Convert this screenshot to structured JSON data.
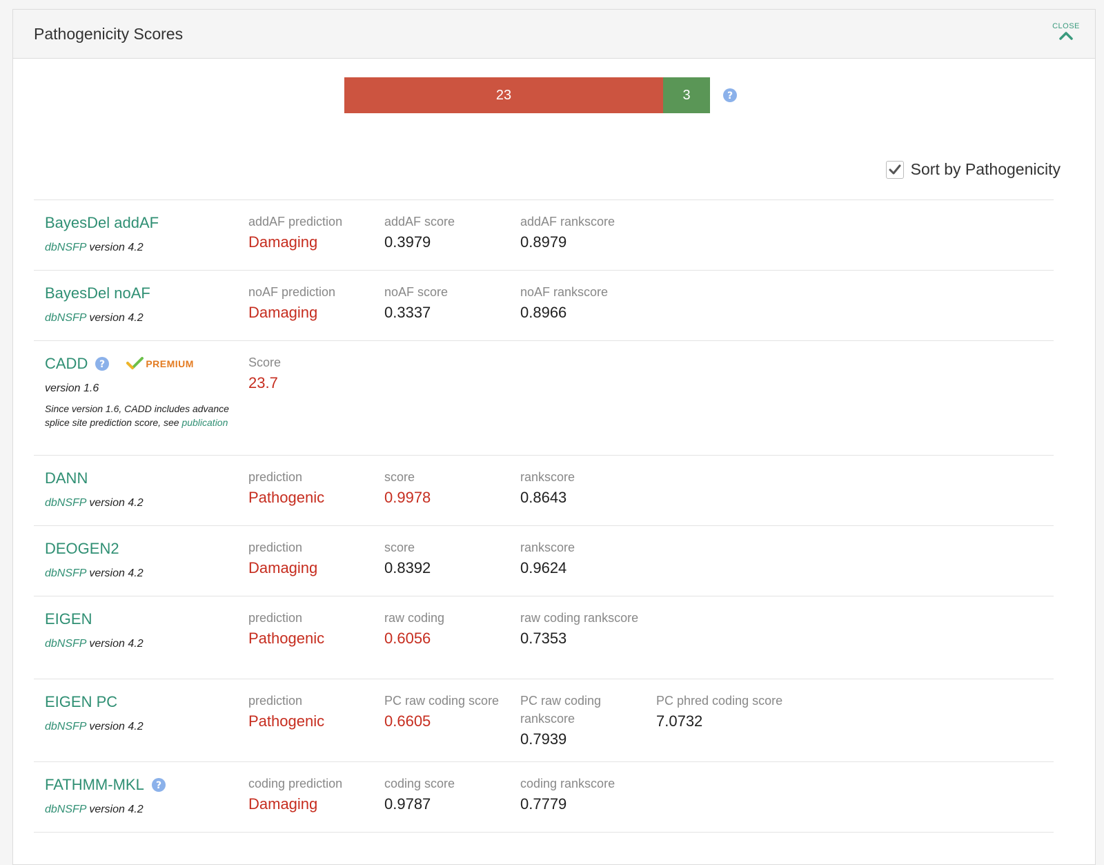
{
  "header": {
    "title": "Pathogenicity Scores",
    "close_label": "CLOSE"
  },
  "summary": {
    "damaging_count": "23",
    "benign_count": "3",
    "damaging_color": "#cc5440",
    "benign_color": "#5a9656"
  },
  "sort": {
    "label": "Sort by Pathogenicity",
    "checked": true
  },
  "rows": [
    {
      "name": "BayesDel addAF",
      "db": "dbNSFP",
      "version": " version 4.2",
      "metrics": [
        {
          "label": "addAF prediction",
          "value": "Damaging",
          "color": "red"
        },
        {
          "label": "addAF score",
          "value": "0.3979",
          "color": "dark"
        },
        {
          "label": "addAF rankscore",
          "value": "0.8979",
          "color": "dark"
        }
      ]
    },
    {
      "name": "BayesDel noAF",
      "db": "dbNSFP",
      "version": " version 4.2",
      "metrics": [
        {
          "label": "noAF prediction",
          "value": "Damaging",
          "color": "red"
        },
        {
          "label": "noAF score",
          "value": "0.3337",
          "color": "dark"
        },
        {
          "label": "noAF rankscore",
          "value": "0.8966",
          "color": "dark"
        }
      ]
    },
    {
      "name": "CADD",
      "premium_label": "PREMIUM",
      "version": "version 1.6",
      "note": "Since version 1.6, CADD includes advance splice site prediction score, see ",
      "note_link": "publication",
      "metrics": [
        {
          "label": "Score",
          "value": "23.7",
          "color": "red"
        }
      ]
    },
    {
      "name": "DANN",
      "db": "dbNSFP",
      "version": " version 4.2",
      "metrics": [
        {
          "label": "prediction",
          "value": "Pathogenic",
          "color": "red"
        },
        {
          "label": "score",
          "value": "0.9978",
          "color": "red"
        },
        {
          "label": "rankscore",
          "value": "0.8643",
          "color": "dark"
        }
      ]
    },
    {
      "name": "DEOGEN2",
      "db": "dbNSFP",
      "version": " version 4.2",
      "metrics": [
        {
          "label": "prediction",
          "value": "Damaging",
          "color": "red"
        },
        {
          "label": "score",
          "value": "0.8392",
          "color": "dark"
        },
        {
          "label": "rankscore",
          "value": "0.9624",
          "color": "dark"
        }
      ]
    },
    {
      "name": "EIGEN",
      "db": "dbNSFP",
      "version": " version 4.2",
      "metrics": [
        {
          "label": "prediction",
          "value": "Pathogenic",
          "color": "red"
        },
        {
          "label": "raw coding",
          "value": "0.6056",
          "color": "red"
        },
        {
          "label": "raw coding rankscore",
          "value": "0.7353",
          "color": "dark"
        }
      ]
    },
    {
      "name": "EIGEN PC",
      "db": "dbNSFP",
      "version": " version 4.2",
      "metrics": [
        {
          "label": "prediction",
          "value": "Pathogenic",
          "color": "red"
        },
        {
          "label": "PC raw coding score",
          "value": "0.6605",
          "color": "red"
        },
        {
          "label": "PC raw coding rankscore",
          "value": "0.7939",
          "color": "dark"
        },
        {
          "label": "PC phred coding score",
          "value": "7.0732",
          "color": "dark"
        }
      ]
    },
    {
      "name": "FATHMM-MKL",
      "db": "dbNSFP",
      "version": " version 4.2",
      "metrics": [
        {
          "label": "coding prediction",
          "value": "Damaging",
          "color": "red"
        },
        {
          "label": "coding score",
          "value": "0.9787",
          "color": "dark"
        },
        {
          "label": "coding rankscore",
          "value": "0.7779",
          "color": "dark"
        }
      ]
    }
  ]
}
